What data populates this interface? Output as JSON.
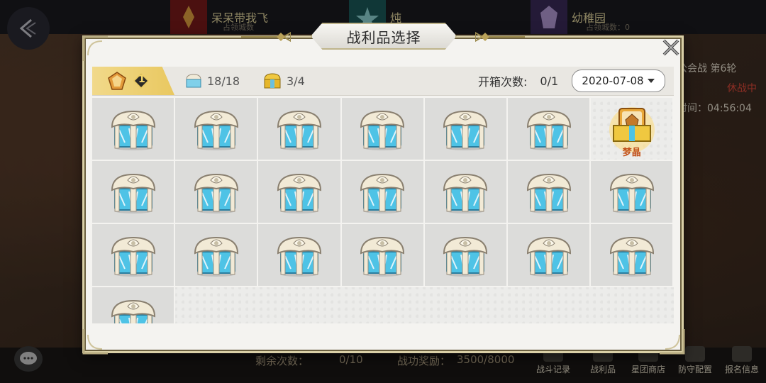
{
  "background": {
    "guilds": [
      {
        "name": "呆呆带我飞",
        "sub": "占领城数"
      },
      {
        "name": "炖",
        "sub": ""
      },
      {
        "name": "幼稚园",
        "sub": "占领城数：0"
      }
    ],
    "right_info": {
      "line1": "公会战  第6轮",
      "line2": "休战中",
      "line3": "时间：04:56:04"
    },
    "bottom_stats": [
      {
        "label": "剩余次数：",
        "value": "0/10"
      },
      {
        "label": "战功奖励：",
        "value": "3500/8000"
      }
    ],
    "nav": [
      "战斗记录",
      "战利品",
      "星团商店",
      "防守配置",
      "报名信息"
    ]
  },
  "modal": {
    "title": "战利品选择",
    "tab_badge": "1",
    "stat_chests": "18/18",
    "stat_gold_chests": "3/4",
    "open_label": "开箱次数:",
    "open_value": "0/1",
    "date": "2020-07-08",
    "claimed_reward_name": "梦晶"
  },
  "chests": {
    "total": 22,
    "claimed_index": 6,
    "columns": 7
  },
  "colors": {
    "accent_gold": "#e9c860",
    "chest_blue": "#4ec3e6",
    "chest_cream": "#f2ead6"
  }
}
